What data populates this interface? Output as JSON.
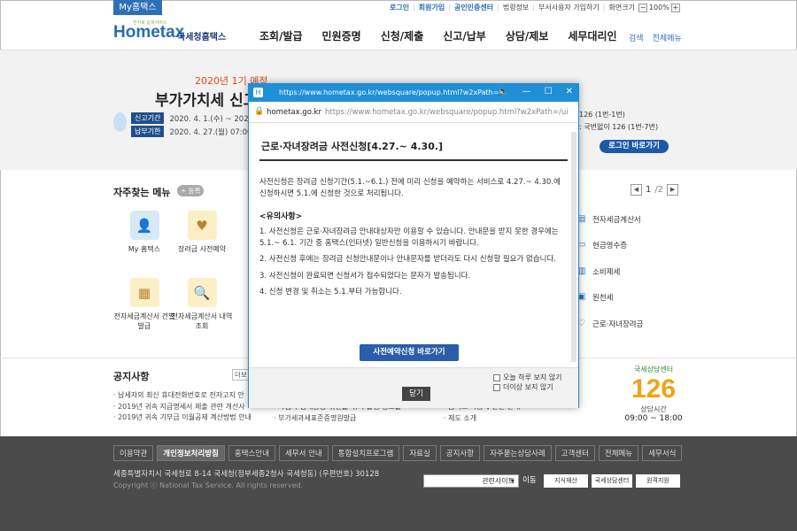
{
  "topbar": {
    "my_tab": "My홈택스",
    "links": [
      "로그인",
      "회원가입",
      "공인인증센터",
      "법령정보",
      "부서사용자 가입하기",
      "화면크기"
    ],
    "zoom_minus": "−",
    "zoom_level": "100%",
    "zoom_plus": "+"
  },
  "header": {
    "logo_tag": "전자로 납세서비스",
    "logo_main": "Hometax",
    "logo_sub": "국세청홈택스",
    "menu": [
      "조회/발급",
      "민원증명",
      "신청/제출",
      "신고/납부",
      "상담/제보",
      "세무대리인"
    ],
    "search_label": "검색",
    "allmenu_label": "전체메뉴"
  },
  "banner": {
    "year_note": "2020년 1기 예정",
    "title": "부가가치세 신고",
    "row1_badge": "신고기간",
    "row1_text": "2020. 4. 1.(수) ~ 2020. 4.",
    "row2_badge": "납부기한",
    "row2_text": "2020. 4. 27.(월) 07:00 ~",
    "right1": "126 (1번-1번)",
    "right2": ": 국번없이 126 (1번-7번)",
    "login_button": "로그인 바로가기"
  },
  "favorites": {
    "title": "자주찾는 메뉴",
    "add_label": "+ 등록",
    "page_current": "1",
    "page_total": "/2",
    "tiles": [
      {
        "label": "My 홈택스",
        "icon": "user-icon",
        "glyph": "👤",
        "color": "blue"
      },
      {
        "label": "장려금 사전예약",
        "icon": "heart-icon",
        "glyph": "♥",
        "color": "yel"
      },
      {
        "label": "전자세금계산서 건별발급",
        "icon": "calculator-icon",
        "glyph": "▦",
        "color": "yel"
      },
      {
        "label": "전자세금계산서 내역조회",
        "icon": "search-doc-icon",
        "glyph": "🔍",
        "color": "yel"
      }
    ],
    "right_items": [
      {
        "label": "전자세금계산서",
        "icon": "doc-icon",
        "glyph": "▤"
      },
      {
        "label": "현금영수증",
        "icon": "receipt-icon",
        "glyph": "▭"
      },
      {
        "label": "소비제세",
        "icon": "goods-icon",
        "glyph": "▥"
      },
      {
        "label": "원천세",
        "icon": "tax-icon",
        "glyph": "▣"
      },
      {
        "label": "근로·자녀장려금",
        "icon": "heart-icon",
        "glyph": "♡"
      }
    ]
  },
  "notices": {
    "title": "공지사항",
    "more": "더보",
    "col1": [
      "납세자의 최신 휴대전화번호로 전자고지 안",
      "2019년 귀속 지급명세서 제출 관련 개선사",
      "2019년 귀속 기부금 이월공제 계산방법 안내"
    ],
    "col2": [
      "사업자 납세증명서(원클릭)의 발행 정보를",
      "부가세과세표준증명원발급"
    ],
    "col3": [
      "홈택스 이용에 관한 안내",
      "제도 소개"
    ]
  },
  "center126": {
    "top": "국세상담센터",
    "number": "126",
    "label": "상담시간",
    "hours": "09:00 ~ 18:00"
  },
  "footer": {
    "links": [
      "이용약관",
      "개인정보처리방침",
      "홈택스안내",
      "세무서 안내",
      "통합설치프로그램",
      "자료실",
      "공지사항",
      "자주묻는상담사례",
      "고객센터",
      "전체메뉴",
      "세무서식"
    ],
    "address": "세종특별자치시 국세청로 8-14 국세청(정부세종2청사 국세청동) (우편번호) 30128",
    "copyright": "Copyright ⓒ National Tax Service. All rights reserved.",
    "related_select": "관련사이트",
    "go_label": "이동",
    "badges": [
      "지식재산",
      "국세상담센터",
      "원격지원"
    ]
  },
  "popup": {
    "window_url": "https://www.hometax.go.kr/websquare/popup.html?w2xPath=",
    "address_host": "hometax.go.kr",
    "address_path": "https://www.hometax.go.kr/websquare/popup.html?w2xPath=/ui",
    "heading": "근로·자녀장려금 사전신청[4.27.~ 4.30.]",
    "intro": "사전신청은 장려금 신청기간(5.1.~6.1.) 전에 미리 신청을 예약하는 서비스로 4.27.~ 4.30.에 신청하시면 5.1.에 신청한 것으로 처리됩니다.",
    "notice_title": "<유의사항>",
    "items": [
      "1. 사전신청은 근로·자녀장려금 안내대상자만 이용할 수 있습니다. 안내문을 받지 못한 경우에는 5.1.~ 6.1. 기간 중 홈택스(인터넷) 일반신청을 이용하시기 바랍니다.",
      "2. 사전신청 후에는 장려금 신청안내문이나 안내문자를 받더라도 다시 신청할 필요가 없습니다.",
      "3. 사전신청이 완료되면 신청서가 접수되었다는 문자가 발송됩니다.",
      "4. 신청 변경 및 취소는 5.1.부터 가능합니다."
    ],
    "main_button": "사전예약신청 바로가기",
    "close_button": "닫기",
    "check_today": "오늘 하루 보지 않기",
    "check_never": "더이상 보지 않기"
  }
}
